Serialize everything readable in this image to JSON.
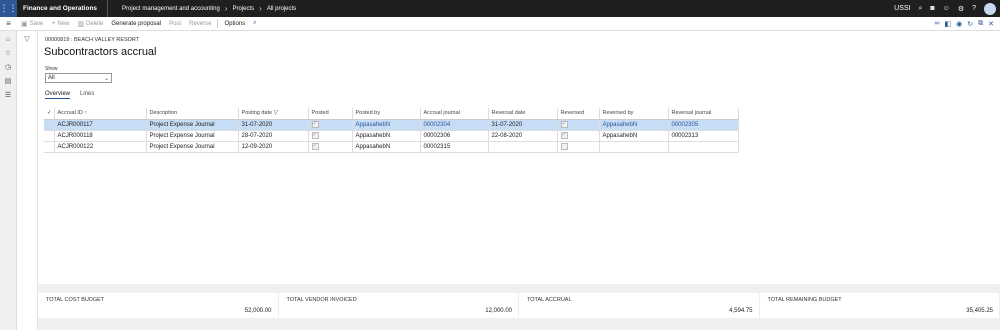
{
  "app": {
    "name": "Finance and Operations",
    "company": "USSI"
  },
  "breadcrumb": [
    "Project management and accounting",
    "Projects",
    "All projects"
  ],
  "actions": [
    {
      "label": "Save",
      "icon": "save-icon",
      "enabled": false
    },
    {
      "label": "New",
      "icon": "plus-icon",
      "enabled": false
    },
    {
      "label": "Delete",
      "icon": "trash-icon",
      "enabled": false
    },
    {
      "label": "Generate proposal",
      "enabled": true
    },
    {
      "label": "Post",
      "enabled": false
    },
    {
      "label": "Reverse",
      "enabled": false
    },
    {
      "label": "Options",
      "enabled": true
    }
  ],
  "page": {
    "caption": "00000819 : BEACH VALLEY RESORT",
    "title": "Subcontractors accrual",
    "show_label": "Show",
    "show_value": "All",
    "tabs": [
      {
        "label": "Overview",
        "active": true
      },
      {
        "label": "Lines",
        "active": false
      }
    ]
  },
  "grid": {
    "columns": [
      "Accrual ID",
      "Description",
      "Posting date",
      "Posted",
      "Posted by",
      "Accrual journal",
      "Reversal date",
      "Reversed",
      "Reversed by",
      "Reversal journal"
    ],
    "rows": [
      {
        "id": "ACJR000117",
        "description": "Project Expense Journal",
        "posting_date": "31-07-2020",
        "posted": true,
        "posted_by": "AppasahebN",
        "accrual_journal": "00002304",
        "reversal_date": "31-07-2020",
        "reversed": true,
        "reversed_by": "AppasahebN",
        "reversal_journal": "00002305",
        "selected": true
      },
      {
        "id": "ACJR000118",
        "description": "Project Expense Journal",
        "posting_date": "28-07-2020",
        "posted": true,
        "posted_by": "AppasahebN",
        "accrual_journal": "00002306",
        "reversal_date": "22-08-2020",
        "reversed": true,
        "reversed_by": "AppasahebN",
        "reversal_journal": "00002313",
        "selected": false
      },
      {
        "id": "ACJR000122",
        "description": "Project Expense Journal",
        "posting_date": "12-09-2020",
        "posted": true,
        "posted_by": "AppasahebN",
        "accrual_journal": "00002315",
        "reversal_date": "",
        "reversed": false,
        "reversed_by": "",
        "reversal_journal": "",
        "selected": false
      }
    ]
  },
  "totals": [
    {
      "label": "TOTAL COST BUDGET",
      "value": "52,000.00"
    },
    {
      "label": "TOTAL VENDOR INVOICED",
      "value": "12,000.00"
    },
    {
      "label": "TOTAL ACCRUAL",
      "value": "4,594.75"
    },
    {
      "label": "TOTAL REMAINING BUDGET",
      "value": "35,405.25"
    }
  ]
}
